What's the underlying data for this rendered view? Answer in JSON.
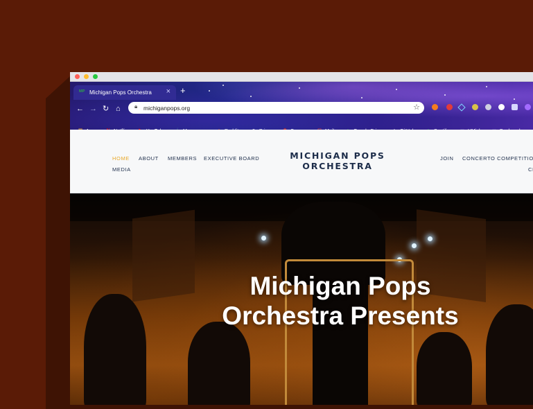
{
  "browser": {
    "tab": {
      "favicon_text": "MP",
      "title": "Michigan Pops Orchestra"
    },
    "url": "michiganpops.org",
    "bookmarks": [
      {
        "label": "Apps",
        "icon": "apps-grid-icon",
        "color": "#e0a03a"
      },
      {
        "label": "Netflix",
        "icon": "netflix-icon",
        "color": "#e50914"
      },
      {
        "label": "YouTube",
        "icon": "youtube-icon",
        "color": "#ff0000"
      },
      {
        "label": "Messenger",
        "icon": "facebook-icon",
        "color": "#3b5998"
      },
      {
        "label": "Reddit",
        "icon": "reddit-icon",
        "color": "#ff4500"
      },
      {
        "label": "Prime",
        "icon": "amazon-icon",
        "color": "#ffffff"
      },
      {
        "label": "Canvas",
        "icon": "canvas-icon",
        "color": "#e13f2b"
      },
      {
        "label": "Mail",
        "icon": "mail-icon",
        "color": "#ea4335"
      },
      {
        "label": "Google Drive",
        "icon": "google-drive-icon",
        "color": "#34a853"
      },
      {
        "label": "GitHub",
        "icon": "github-icon",
        "color": "#ffffff"
      },
      {
        "label": "Spotify",
        "icon": "spotify-icon",
        "color": "#1db954"
      },
      {
        "label": "UMich",
        "icon": "folder-icon",
        "color": "#cfd3ff"
      },
      {
        "label": "Bookmarks",
        "icon": "folder-icon",
        "color": "#cfd3ff"
      }
    ]
  },
  "site": {
    "logo_line1": "MICHIGAN POPS",
    "logo_line2": "ORCHESTRA",
    "nav_left": [
      "HOME",
      "ABOUT",
      "MEMBERS",
      "EXECUTIVE BOARD"
    ],
    "nav_left_row2": "MEDIA",
    "nav_right": [
      "JOIN",
      "CONCERTO COMPETITION"
    ],
    "nav_right_row2_partial": "CI",
    "active_color": "#e8a82a",
    "text_color": "#1d2d4a"
  },
  "hero": {
    "title_line1": "Michigan Pops",
    "title_line2": "Orchestra Presents"
  }
}
